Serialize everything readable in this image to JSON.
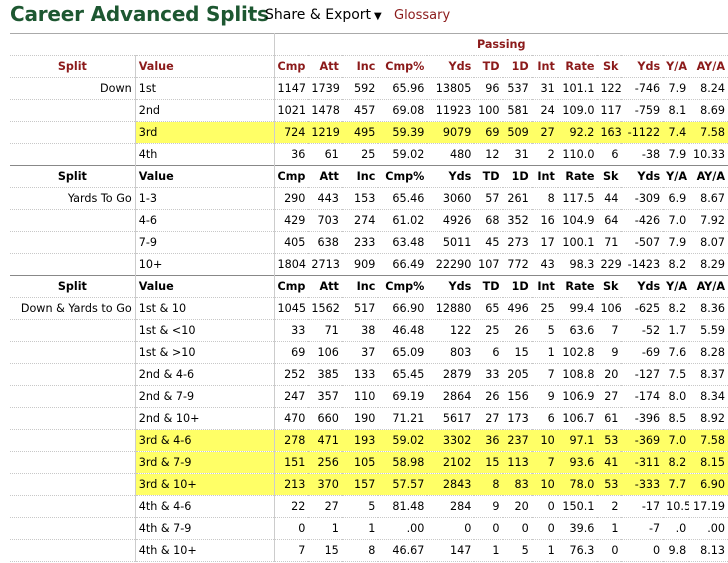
{
  "header": {
    "title": "Career Advanced Splits",
    "share_label": "Share & Export",
    "caret": "▼",
    "glossary_label": "Glossary"
  },
  "table": {
    "over_header": "Passing",
    "split_label": "Split",
    "value_label": "Value",
    "columns": [
      "Cmp",
      "Att",
      "Inc",
      "Cmp%",
      "Yds",
      "TD",
      "1D",
      "Int",
      "Rate",
      "Sk",
      "Yds",
      "Y/A",
      "AY/A"
    ],
    "groups": [
      {
        "split": "Down",
        "rows": [
          {
            "value": "1st",
            "cells": [
              "1147",
              "1739",
              "592",
              "65.96",
              "13805",
              "96",
              "537",
              "31",
              "101.1",
              "122",
              "-746",
              "7.9",
              "8.24"
            ],
            "highlight": false
          },
          {
            "value": "2nd",
            "cells": [
              "1021",
              "1478",
              "457",
              "69.08",
              "11923",
              "100",
              "581",
              "24",
              "109.0",
              "117",
              "-759",
              "8.1",
              "8.69"
            ],
            "highlight": false
          },
          {
            "value": "3rd",
            "cells": [
              "724",
              "1219",
              "495",
              "59.39",
              "9079",
              "69",
              "509",
              "27",
              "92.2",
              "163",
              "-1122",
              "7.4",
              "7.58"
            ],
            "highlight": true
          },
          {
            "value": "4th",
            "cells": [
              "36",
              "61",
              "25",
              "59.02",
              "480",
              "12",
              "31",
              "2",
              "110.0",
              "6",
              "-38",
              "7.9",
              "10.33"
            ],
            "highlight": false
          }
        ]
      },
      {
        "split": "Yards To Go",
        "rows": [
          {
            "value": "1-3",
            "cells": [
              "290",
              "443",
              "153",
              "65.46",
              "3060",
              "57",
              "261",
              "8",
              "117.5",
              "44",
              "-309",
              "6.9",
              "8.67"
            ],
            "highlight": false
          },
          {
            "value": "4-6",
            "cells": [
              "429",
              "703",
              "274",
              "61.02",
              "4926",
              "68",
              "352",
              "16",
              "104.9",
              "64",
              "-426",
              "7.0",
              "7.92"
            ],
            "highlight": false
          },
          {
            "value": "7-9",
            "cells": [
              "405",
              "638",
              "233",
              "63.48",
              "5011",
              "45",
              "273",
              "17",
              "100.1",
              "71",
              "-507",
              "7.9",
              "8.07"
            ],
            "highlight": false
          },
          {
            "value": "10+",
            "cells": [
              "1804",
              "2713",
              "909",
              "66.49",
              "22290",
              "107",
              "772",
              "43",
              "98.3",
              "229",
              "-1423",
              "8.2",
              "8.29"
            ],
            "highlight": false
          }
        ]
      },
      {
        "split": "Down & Yards to Go",
        "rows": [
          {
            "value": "1st & 10",
            "cells": [
              "1045",
              "1562",
              "517",
              "66.90",
              "12880",
              "65",
              "496",
              "25",
              "99.4",
              "106",
              "-625",
              "8.2",
              "8.36"
            ],
            "highlight": false
          },
          {
            "value": "1st & <10",
            "cells": [
              "33",
              "71",
              "38",
              "46.48",
              "122",
              "25",
              "26",
              "5",
              "63.6",
              "7",
              "-52",
              "1.7",
              "5.59"
            ],
            "highlight": false
          },
          {
            "value": "1st & >10",
            "cells": [
              "69",
              "106",
              "37",
              "65.09",
              "803",
              "6",
              "15",
              "1",
              "102.8",
              "9",
              "-69",
              "7.6",
              "8.28"
            ],
            "highlight": false
          },
          {
            "value": "2nd & 4-6",
            "cells": [
              "252",
              "385",
              "133",
              "65.45",
              "2879",
              "33",
              "205",
              "7",
              "108.8",
              "20",
              "-127",
              "7.5",
              "8.37"
            ],
            "highlight": false
          },
          {
            "value": "2nd & 7-9",
            "cells": [
              "247",
              "357",
              "110",
              "69.19",
              "2864",
              "26",
              "156",
              "9",
              "106.9",
              "27",
              "-174",
              "8.0",
              "8.34"
            ],
            "highlight": false
          },
          {
            "value": "2nd & 10+",
            "cells": [
              "470",
              "660",
              "190",
              "71.21",
              "5617",
              "27",
              "173",
              "6",
              "106.7",
              "61",
              "-396",
              "8.5",
              "8.92"
            ],
            "highlight": false
          },
          {
            "value": "3rd & 4-6",
            "cells": [
              "278",
              "471",
              "193",
              "59.02",
              "3302",
              "36",
              "237",
              "10",
              "97.1",
              "53",
              "-369",
              "7.0",
              "7.58"
            ],
            "highlight": true
          },
          {
            "value": "3rd & 7-9",
            "cells": [
              "151",
              "256",
              "105",
              "58.98",
              "2102",
              "15",
              "113",
              "7",
              "93.6",
              "41",
              "-311",
              "8.2",
              "8.15"
            ],
            "highlight": true
          },
          {
            "value": "3rd & 10+",
            "cells": [
              "213",
              "370",
              "157",
              "57.57",
              "2843",
              "8",
              "83",
              "10",
              "78.0",
              "53",
              "-333",
              "7.7",
              "6.90"
            ],
            "highlight": true
          },
          {
            "value": "4th & 4-6",
            "cells": [
              "22",
              "27",
              "5",
              "81.48",
              "284",
              "9",
              "20",
              "0",
              "150.1",
              "2",
              "-17",
              "10.5",
              "17.19"
            ],
            "highlight": false
          },
          {
            "value": "4th & 7-9",
            "cells": [
              "0",
              "1",
              "1",
              ".00",
              "0",
              "0",
              "0",
              "0",
              "39.6",
              "1",
              "-7",
              ".0",
              ".00"
            ],
            "highlight": false
          },
          {
            "value": "4th & 10+",
            "cells": [
              "7",
              "15",
              "8",
              "46.67",
              "147",
              "1",
              "5",
              "1",
              "76.3",
              "0",
              "0",
              "9.8",
              "8.13"
            ],
            "highlight": false
          }
        ]
      }
    ]
  }
}
